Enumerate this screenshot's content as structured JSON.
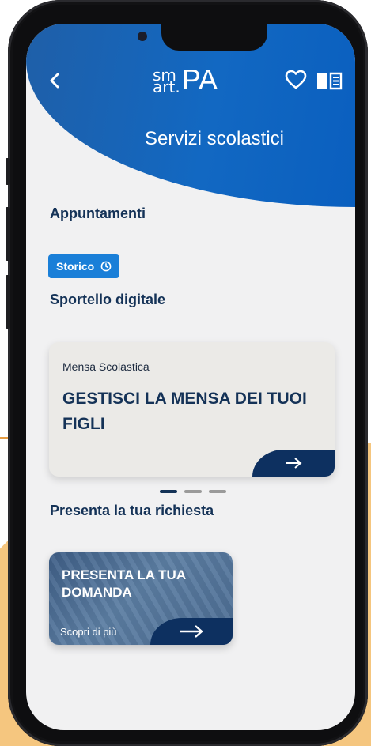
{
  "app": {
    "logo_top": "sm",
    "logo_bottom": "art.",
    "logo_main": "PA",
    "page_title": "Servizi scolastici"
  },
  "icons": {
    "back": "chevron-left-icon",
    "favorite": "heart-icon",
    "book": "book-icon",
    "clock": "clock-icon",
    "arrow": "arrow-right-icon"
  },
  "appointments": {
    "title": "Appuntamenti",
    "history_label": "Storico"
  },
  "digital_desk": {
    "title": "Sportello digitale",
    "card": {
      "category": "Mensa Scolastica",
      "title": "GESTISCI LA MENSA DEI TUOI FIGLI"
    },
    "carousel_pages": 3,
    "active_page": 1
  },
  "request": {
    "title": "Presenta la tua richiesta",
    "card": {
      "title": "PRESENTA LA TUA DOMANDA",
      "link": "Scopri di più"
    }
  },
  "colors": {
    "header_blue": "#1268c2",
    "navy": "#143257",
    "badge_blue": "#1a7fd8",
    "accent_orange": "#f5c67f"
  }
}
